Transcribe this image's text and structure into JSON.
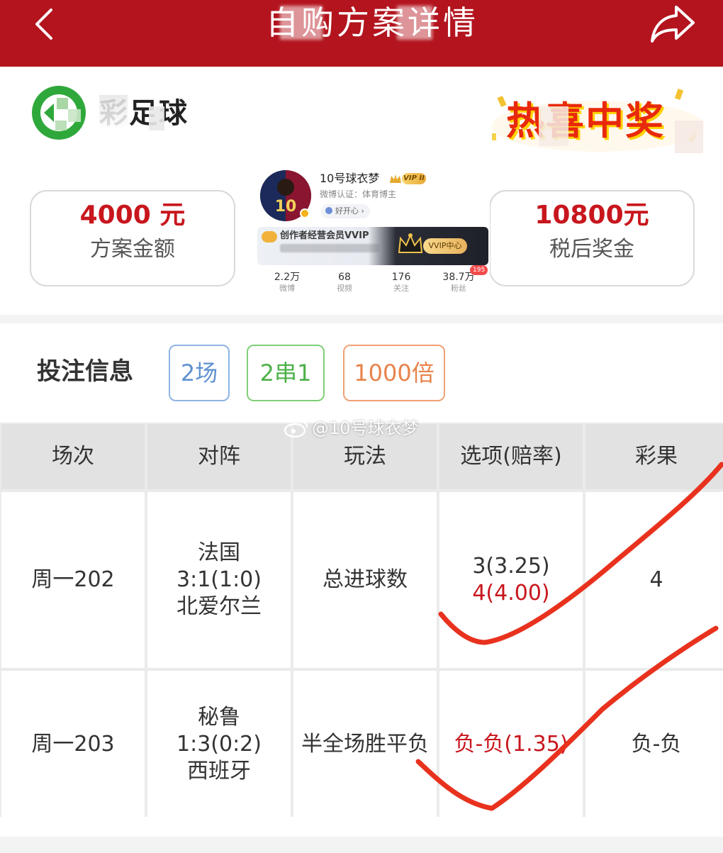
{
  "header": {
    "title": "自购方案详情",
    "back_icon": "back-arrow-icon",
    "share_icon": "share-icon",
    "bg_color": "#b3141e"
  },
  "brand": {
    "name": "彩足球",
    "logo_icon": "football-logo-icon",
    "promo_text": "热喜中奖"
  },
  "stats": {
    "amount_value": "4000 元",
    "amount_label": "方案金额",
    "prize_value": "10800元",
    "prize_label": "税后奖金"
  },
  "profile": {
    "name": "10号球衣梦",
    "vip_badge": "VIP II",
    "verify": "微博认证：体育博主",
    "mood": "好开心 ›",
    "vvip_title": "创作者经营会员VVIP",
    "vvip_button": "VVIP中心",
    "stats": [
      {
        "num": "2.2万",
        "label": "微博"
      },
      {
        "num": "68",
        "label": "视频"
      },
      {
        "num": "176",
        "label": "关注"
      },
      {
        "num": "38.7万",
        "label": "粉丝"
      }
    ],
    "fans_badge": "195"
  },
  "bet_info": {
    "title": "投注信息",
    "tags": [
      "2场",
      "2串1",
      "1000倍"
    ]
  },
  "table": {
    "headers": [
      "场次",
      "对阵",
      "玩法",
      "选项(赔率)",
      "彩果"
    ],
    "rows": [
      {
        "match_no": "周一202",
        "home": "法国",
        "score": "3:1(1:0)",
        "away": "北爱尔兰",
        "play": "总进球数",
        "option_1": "3(3.25)",
        "option_2": "4(4.00)",
        "result": "4"
      },
      {
        "match_no": "周一203",
        "home": "秘鲁",
        "score": "1:3(0:2)",
        "away": "西班牙",
        "play": "半全场胜平负",
        "option_1": "负-负(1.35)",
        "result": "负-负"
      }
    ]
  },
  "watermark": "@10号球衣梦",
  "colors": {
    "accent_red": "#c8161d",
    "check_red": "#e8321e",
    "tag_blue": "#5f91cf",
    "tag_green": "#4eb14a",
    "tag_orange": "#e8834b"
  }
}
